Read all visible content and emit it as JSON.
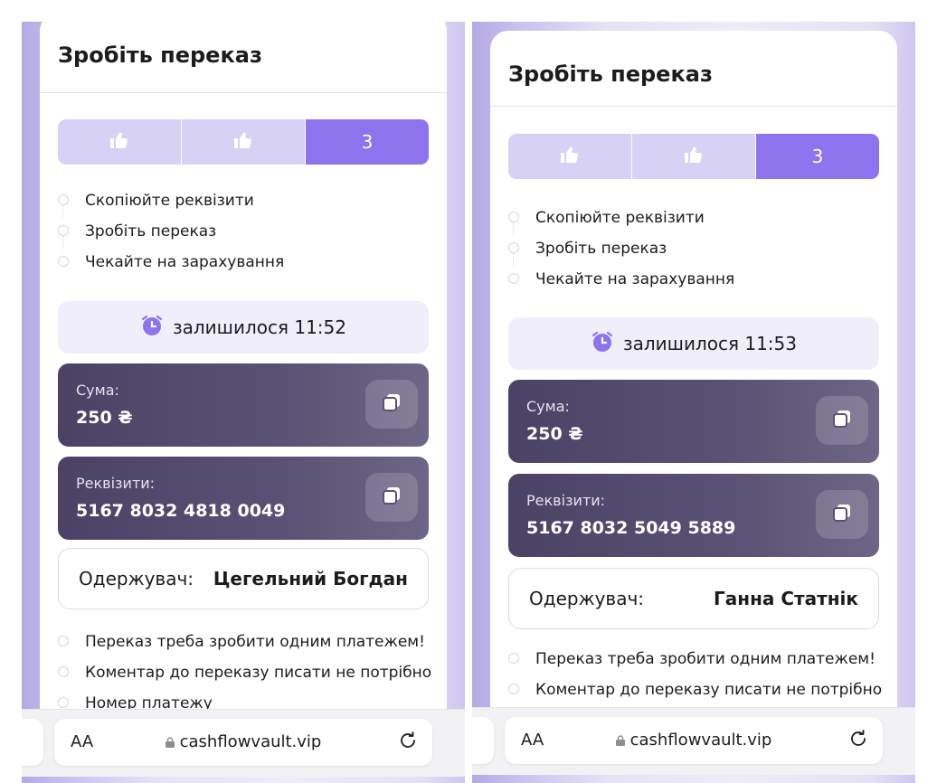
{
  "screens": [
    {
      "title": "Зробіть переказ",
      "stepper": {
        "step3_label": "3"
      },
      "steps": [
        "Скопіюйте реквізити",
        "Зробіть переказ",
        "Чекайте на зарахування"
      ],
      "timer": "залишилося 11:52",
      "amount": {
        "label": "Сума:",
        "value": "250 ₴"
      },
      "requisites": {
        "label": "Реквізити:",
        "value": "5167 8032 4818 0049"
      },
      "recipient": {
        "label": "Одержувач:",
        "name": "Цегельний Богдан"
      },
      "notes": [
        "Переказ треба зробити одним платежем!",
        "Коментар до переказу писати не потрібно",
        "Номер платежу"
      ],
      "browser": {
        "aa": "AA",
        "url": "cashflowvault.vip"
      }
    },
    {
      "title": "Зробіть переказ",
      "stepper": {
        "step3_label": "3"
      },
      "steps": [
        "Скопіюйте реквізити",
        "Зробіть переказ",
        "Чекайте на зарахування"
      ],
      "timer": "залишилося 11:53",
      "amount": {
        "label": "Сума:",
        "value": "250 ₴"
      },
      "requisites": {
        "label": "Реквізити:",
        "value": "5167 8032 5049 5889"
      },
      "recipient": {
        "label": "Одержувач:",
        "name": "Ганна Статнік"
      },
      "notes": [
        "Переказ треба зробити одним платежем!",
        "Коментар до переказу писати не потрібно"
      ],
      "browser": {
        "aa": "AA",
        "url": "cashflowvault.vip"
      }
    }
  ],
  "icons": {
    "step_done": "thumbs-up-icon",
    "timer": "alarm-clock-icon",
    "copy": "copy-icon",
    "lock": "lock-icon",
    "reload": "reload-icon"
  },
  "colors": {
    "accent": "#8d74ee",
    "step_done": "#d8d1f6",
    "timer_bg": "#f1eefc",
    "dark_card": "#4b4266",
    "timer_icon": "#8d74ee"
  }
}
